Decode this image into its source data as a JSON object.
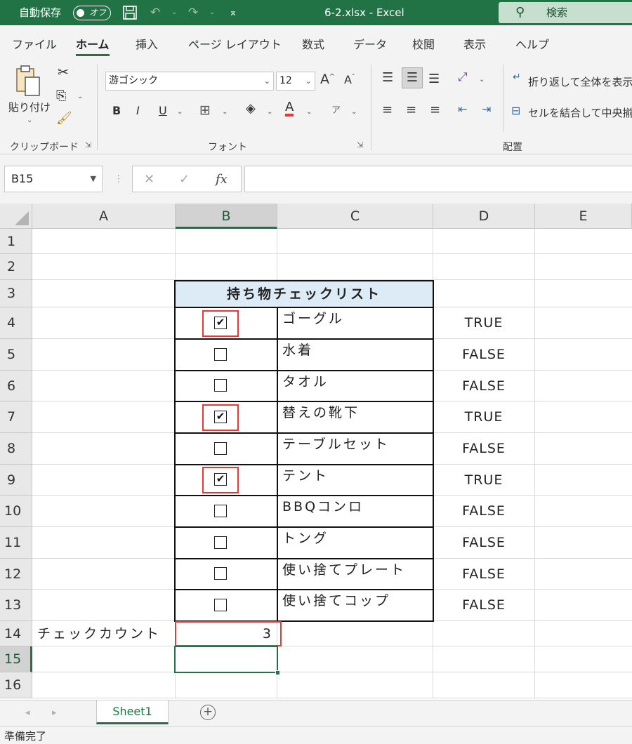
{
  "titlebar": {
    "autosave_label": "自動保存",
    "autosave_state": "オフ",
    "document_title": "6-2.xlsx  -  Excel",
    "search_placeholder": "検索"
  },
  "ribbon_tabs": [
    "ファイル",
    "ホーム",
    "挿入",
    "ページ レイアウト",
    "数式",
    "データ",
    "校閲",
    "表示",
    "ヘルプ"
  ],
  "active_tab": "ホーム",
  "ribbon": {
    "paste_label": "貼り付け",
    "clipboard_group": "クリップボード",
    "font_name": "游ゴシック",
    "font_size": "12",
    "font_group": "フォント",
    "bold": "B",
    "italic": "I",
    "underline": "U",
    "wrap_text": "折り返して全体を表示する",
    "merge_center": "セルを結合して中央揃え",
    "alignment_group": "配置"
  },
  "formula_bar": {
    "name_box": "B15",
    "formula": ""
  },
  "grid": {
    "columns": [
      "A",
      "B",
      "C",
      "D",
      "E"
    ],
    "selected_column": "B",
    "rows": [
      "1",
      "2",
      "3",
      "4",
      "5",
      "6",
      "7",
      "8",
      "9",
      "10",
      "11",
      "12",
      "13",
      "14",
      "15",
      "16"
    ],
    "selected_row": "15",
    "table_title": "持ち物チェックリスト",
    "items": [
      {
        "name": "ゴーグル",
        "checked": true,
        "value": "TRUE"
      },
      {
        "name": "水着",
        "checked": false,
        "value": "FALSE"
      },
      {
        "name": "タオル",
        "checked": false,
        "value": "FALSE"
      },
      {
        "name": "替えの靴下",
        "checked": true,
        "value": "TRUE"
      },
      {
        "name": "テーブルセット",
        "checked": false,
        "value": "FALSE"
      },
      {
        "name": "テント",
        "checked": true,
        "value": "TRUE"
      },
      {
        "name": "BBQコンロ",
        "checked": false,
        "value": "FALSE"
      },
      {
        "name": "トング",
        "checked": false,
        "value": "FALSE"
      },
      {
        "name": "使い捨てプレート",
        "checked": false,
        "value": "FALSE"
      },
      {
        "name": "使い捨てコップ",
        "checked": false,
        "value": "FALSE"
      }
    ],
    "count_label": "チェックカウント",
    "count_value": "3"
  },
  "sheet_tabs": [
    "Sheet1"
  ],
  "status": "準備完了",
  "colors": {
    "excel_green": "#217346",
    "header_fill": "#ddebf7",
    "highlight_red": "#e53935"
  }
}
